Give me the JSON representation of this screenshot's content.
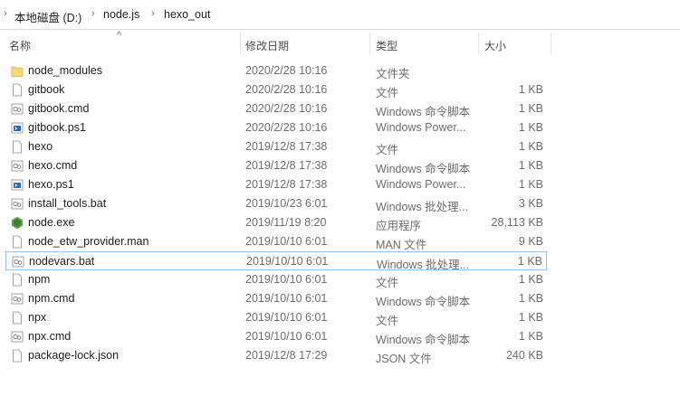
{
  "breadcrumb": {
    "items": [
      "本地磁盘 (D:)",
      "node.js",
      "hexo_out"
    ]
  },
  "columns": {
    "name": "名称",
    "date": "修改日期",
    "type": "类型",
    "size": "大小"
  },
  "files": [
    {
      "name": "node_modules",
      "date": "2020/2/28 10:16",
      "type": "文件夹",
      "size": "",
      "icon": "folder-icon"
    },
    {
      "name": "gitbook",
      "date": "2020/2/28 10:16",
      "type": "文件",
      "size": "1 KB",
      "icon": "file-icon"
    },
    {
      "name": "gitbook.cmd",
      "date": "2020/2/28 10:16",
      "type": "Windows 命令脚本",
      "size": "1 KB",
      "icon": "cmd-icon"
    },
    {
      "name": "gitbook.ps1",
      "date": "2020/2/28 10:16",
      "type": "Windows Power...",
      "size": "1 KB",
      "icon": "powershell-icon"
    },
    {
      "name": "hexo",
      "date": "2019/12/8 17:38",
      "type": "文件",
      "size": "1 KB",
      "icon": "file-icon"
    },
    {
      "name": "hexo.cmd",
      "date": "2019/12/8 17:38",
      "type": "Windows 命令脚本",
      "size": "1 KB",
      "icon": "cmd-icon"
    },
    {
      "name": "hexo.ps1",
      "date": "2019/12/8 17:38",
      "type": "Windows Power...",
      "size": "1 KB",
      "icon": "powershell-icon"
    },
    {
      "name": "install_tools.bat",
      "date": "2019/10/23 6:01",
      "type": "Windows 批处理...",
      "size": "3 KB",
      "icon": "cmd-icon"
    },
    {
      "name": "node.exe",
      "date": "2019/11/19 8:20",
      "type": "应用程序",
      "size": "28,113 KB",
      "icon": "node-exe-icon"
    },
    {
      "name": "node_etw_provider.man",
      "date": "2019/10/10 6:01",
      "type": "MAN 文件",
      "size": "9 KB",
      "icon": "file-icon"
    },
    {
      "name": "nodevars.bat",
      "date": "2019/10/10 6:01",
      "type": "Windows 批处理...",
      "size": "1 KB",
      "icon": "cmd-icon",
      "selected": true
    },
    {
      "name": "npm",
      "date": "2019/10/10 6:01",
      "type": "文件",
      "size": "1 KB",
      "icon": "file-icon"
    },
    {
      "name": "npm.cmd",
      "date": "2019/10/10 6:01",
      "type": "Windows 命令脚本",
      "size": "1 KB",
      "icon": "cmd-icon"
    },
    {
      "name": "npx",
      "date": "2019/10/10 6:01",
      "type": "文件",
      "size": "1 KB",
      "icon": "file-icon"
    },
    {
      "name": "npx.cmd",
      "date": "2019/10/10 6:01",
      "type": "Windows 命令脚本",
      "size": "1 KB",
      "icon": "cmd-icon"
    },
    {
      "name": "package-lock.json",
      "date": "2019/12/8 17:29",
      "type": "JSON 文件",
      "size": "240 KB",
      "icon": "file-icon"
    }
  ],
  "colors": {
    "selected_border": "#99c2e6",
    "folder": "#f8d775",
    "node_green": "#5fa04e",
    "ps_blue": "#2b6cb0"
  }
}
